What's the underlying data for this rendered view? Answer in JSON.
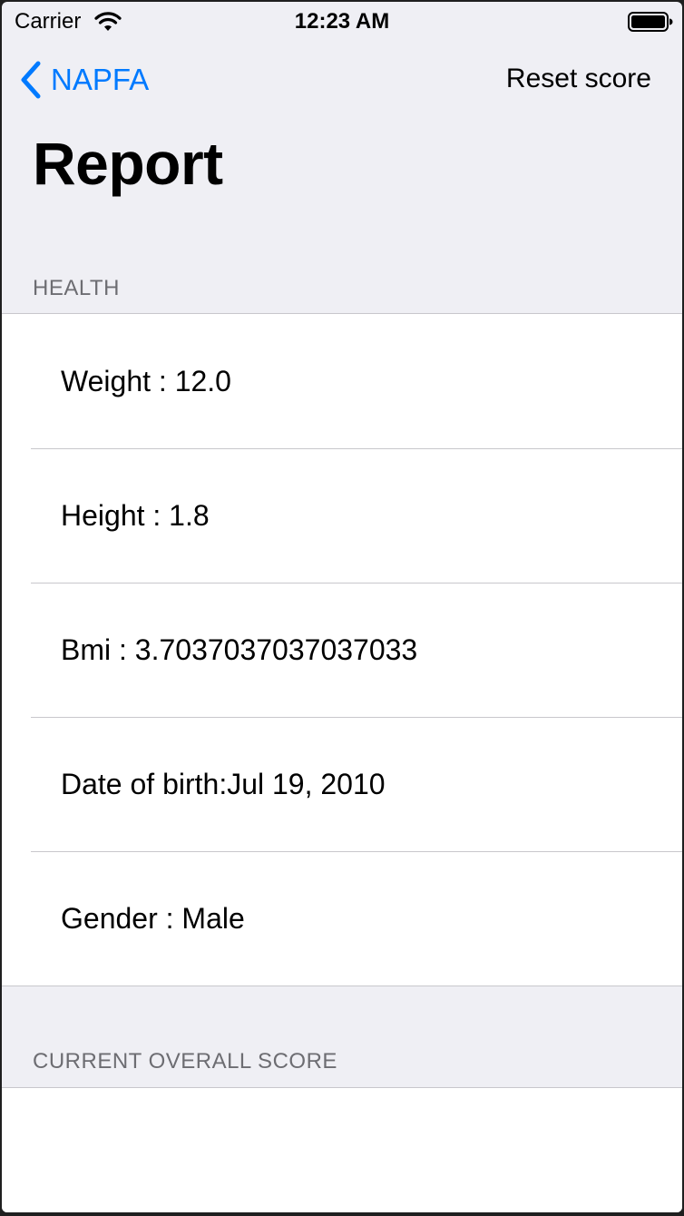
{
  "status_bar": {
    "carrier": "Carrier",
    "time": "12:23 AM"
  },
  "nav": {
    "back_label": "NAPFA",
    "right_button_label": "Reset score",
    "title": "Report"
  },
  "sections": {
    "health": {
      "header": "HEALTH",
      "rows": [
        {
          "label": "Weight : 12.0"
        },
        {
          "label": "Height : 1.8"
        },
        {
          "label": "Bmi : 3.7037037037037033"
        },
        {
          "label": "Date of birth:Jul 19, 2010"
        },
        {
          "label": "Gender : Male"
        }
      ]
    },
    "score": {
      "header": "CURRENT OVERALL SCORE"
    }
  },
  "colors": {
    "tint": "#007aff",
    "grouped_background": "#efeff4",
    "separator": "#c8c7cc",
    "section_header_text": "#6d6d72"
  },
  "icons": {
    "back": "chevron-left-icon",
    "wifi": "wifi-icon",
    "battery": "battery-icon"
  }
}
